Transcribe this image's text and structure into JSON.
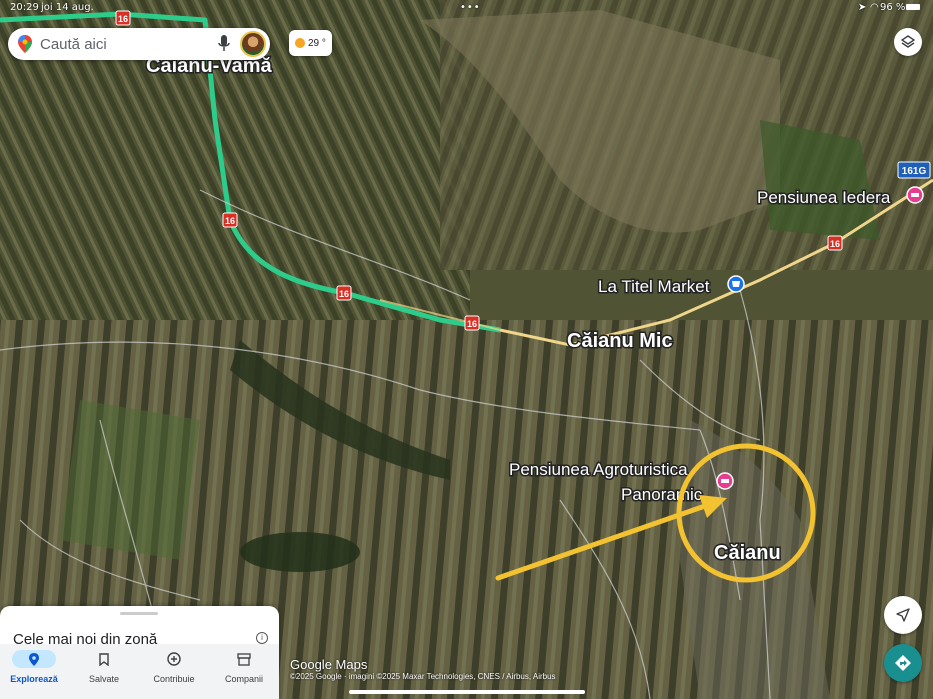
{
  "status_bar": {
    "time": "20:29",
    "date": "joi 14 aug.",
    "battery": "96 %"
  },
  "search": {
    "placeholder": "Caută aici"
  },
  "weather": {
    "temp": "29 °"
  },
  "map": {
    "places": {
      "caianu_vama": "Căianu-Vamă",
      "caianu_mic": "Căianu Mic",
      "caianu": "Căianu",
      "pensiunea_iedera": "Pensiunea Iedera",
      "la_titel": "La Titel Market",
      "pensiunea_agro_line1": "Pensiunea Agroturistica",
      "pensiunea_agro_line2": "Panoramic"
    },
    "road_shields": [
      "16",
      "16",
      "16",
      "16",
      "16",
      "161G"
    ],
    "colors": {
      "route": "#2ecc8a",
      "road": "#f0d68a",
      "annotation": "#f2c230",
      "hotel_pin": "#e63d8f",
      "shop_pin": "#1a73e8"
    }
  },
  "panel": {
    "title": "Cele mai noi din zonă",
    "nav": [
      {
        "label": "Explorează",
        "icon": "location-pin-icon"
      },
      {
        "label": "Salvate",
        "icon": "bookmark-icon"
      },
      {
        "label": "Contribuie",
        "icon": "add-circle-icon"
      },
      {
        "label": "Companii",
        "icon": "storefront-icon"
      }
    ]
  },
  "attribution": {
    "logo": "Google Maps",
    "copyright": "©2025 Google · imagini ©2025 Maxar Technologies, CNES / Airbus, Airbus"
  }
}
